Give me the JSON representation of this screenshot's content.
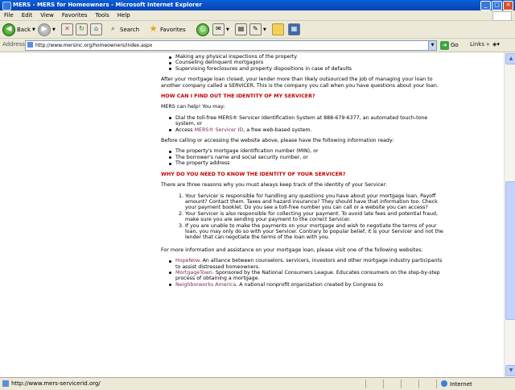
{
  "window": {
    "title": "MERS - MERS for Homeowners - Microsoft Internet Explorer",
    "buttons": [
      "_",
      "□",
      "✕"
    ]
  },
  "menu": [
    "File",
    "Edit",
    "View",
    "Favorites",
    "Tools",
    "Help"
  ],
  "toolbar": {
    "back": "Back",
    "search": "Search",
    "favorites": "Favorites"
  },
  "address": {
    "label": "Address",
    "url": "http://www.mersinc.org/homeowners/index.aspx",
    "go": "Go",
    "links": "Links"
  },
  "page": {
    "top_bullets": [
      "Making any physical inspections of the property",
      "Counseling delinquent mortgagors",
      "Supervising foreclosures and property dispositions in case of defaults"
    ],
    "intro": "After your mortgage loan closed, your lender more than likely outsourced the job of managing your loan to another company called a SERVICER. This is the company you call when you have questions about your loan.",
    "h1": "HOW CAN I FIND OUT THE IDENTITY OF MY SERVICER?",
    "help": "MERS can help! You may:",
    "b1": "Dial the toll-free MERS® Servicer Identification System at 888-679-6377, an automated touch-tone system, or",
    "b2_pre": "Access ",
    "b2_link": "MERS® Servicer ID",
    "b2_post": ", a free web-based system.",
    "before": "Before calling or accessing the website above, please have the following information ready:",
    "info_bullets": [
      "The property's mortgage identification number (MIN), or",
      "The borrower's name and social security number, or",
      "The property address"
    ],
    "h2": "WHY DO YOU NEED TO KNOW THE IDENTITY OF YOUR SERVICER?",
    "reasons_intro": "There are three reasons why you must always keep track of the identity of your Servicer:",
    "reasons": [
      "Your Servicer is responsible for handling any questions you have about your mortgage loan. Payoff amount? Contact them. Taxes and hazard insurance? They should have that information too. Check your payment booklet. Do you see a toll-free number you can call or a website you can access?",
      "Your Servicer is also responsible for collecting your payment. To avoid late fees and potential fraud, make sure you are sending your payment to the correct Servicer.",
      "If you are unable to make the payments on your mortgage and wish to negotiate the terms of your loan, you may only do so with your Servicer. Contrary to popular belief, it is your Servicer and not the lender that can negotiate the terms of the loan with you."
    ],
    "more": "For more information and assistance on your mortgage loan, please visit one of the following websites:",
    "sites": [
      {
        "link": "HopeNow",
        "text": ". An alliance between counselors, servicers, investors and other mortgage industry participants to assist distressed homeowners."
      },
      {
        "link": "MortgageTown",
        "text": ". Sponsored by the National Consumers League. Educates consumers on the step-by-step process of obtaining a mortgage."
      },
      {
        "link": "Neighborworks America",
        "text": ". A national nonprofit organization created by Congress to"
      }
    ]
  },
  "status": {
    "url": "http://www.mers-servicerid.org/",
    "zone": "Internet"
  }
}
